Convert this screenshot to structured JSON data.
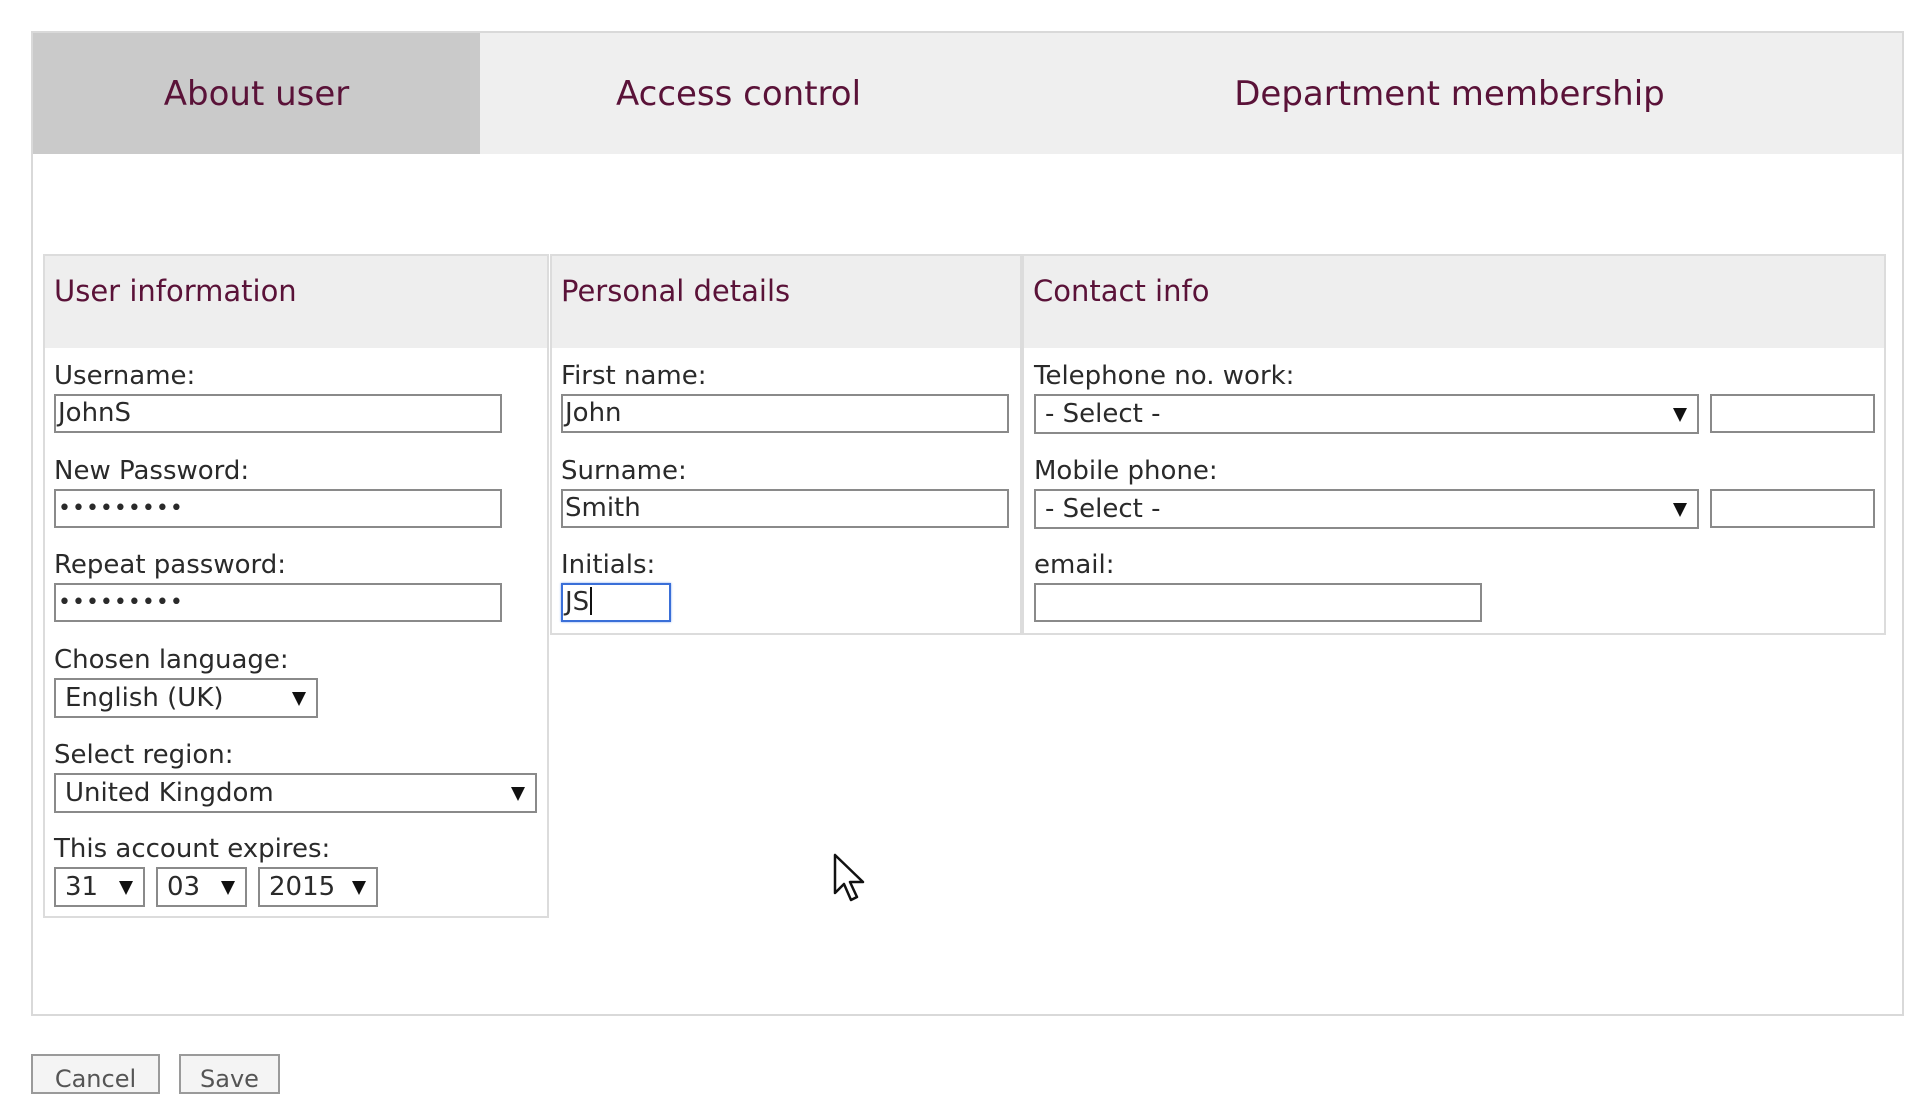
{
  "tabs": [
    {
      "label": "About user",
      "active": true
    },
    {
      "label": "Access control",
      "active": false
    },
    {
      "label": "Department membership",
      "active": false
    }
  ],
  "user_info": {
    "title": "User information",
    "username_label": "Username:",
    "username_value": "JohnS",
    "new_password_label": "New Password:",
    "new_password_value": "•••••••••",
    "repeat_password_label": "Repeat password:",
    "repeat_password_value": "•••••••••",
    "language_label": "Chosen language:",
    "language_value": "English (UK)",
    "region_label": "Select region:",
    "region_value": "United Kingdom",
    "expires_label": "This account expires:",
    "expires_day": "31",
    "expires_month": "03",
    "expires_year": "2015"
  },
  "personal": {
    "title": "Personal details",
    "first_name_label": "First name:",
    "first_name_value": "John",
    "surname_label": "Surname:",
    "surname_value": "Smith",
    "initials_label": "Initials:",
    "initials_value": "JS"
  },
  "contact": {
    "title": "Contact info",
    "work_phone_label": "Telephone no. work:",
    "work_phone_select": "- Select -",
    "work_phone_value": "",
    "mobile_label": "Mobile phone:",
    "mobile_select": "- Select -",
    "mobile_value": "",
    "email_label": "email:",
    "email_value": ""
  },
  "actions": {
    "cancel_label": "Cancel",
    "save_label": "Save"
  },
  "colors": {
    "accent_text": "#5a1238",
    "active_tab": "#cacaca",
    "tab_bar": "#efefef"
  }
}
